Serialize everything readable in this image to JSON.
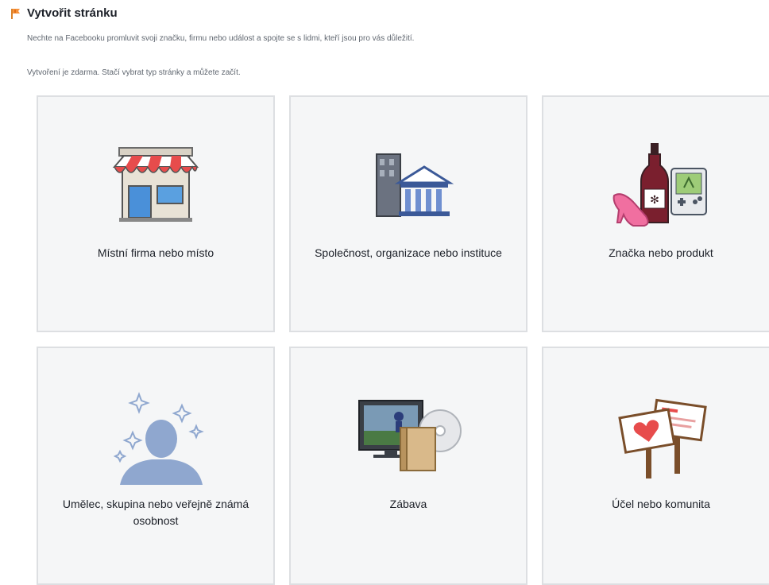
{
  "header": {
    "title": "Vytvořit stránku",
    "description": "Nechte na Facebooku promluvit svoji značku, firmu nebo událost a spojte se s lidmi, kteří jsou pro vás důležití.",
    "note": "Vytvoření je zdarma. Stačí vybrat typ stránky a můžete začít.",
    "flag_icon": "flag-icon",
    "accent": "#f7923b"
  },
  "categories": [
    {
      "label": "Místní firma nebo místo",
      "icon": "storefront-icon"
    },
    {
      "label": "Společnost, organizace nebo instituce",
      "icon": "building-icon"
    },
    {
      "label": "Značka nebo produkt",
      "icon": "products-icon"
    },
    {
      "label": "Umělec, skupina nebo veřejně známá osobnost",
      "icon": "person-sparkle-icon"
    },
    {
      "label": "Zábava",
      "icon": "entertainment-icon"
    },
    {
      "label": "Účel nebo komunita",
      "icon": "signs-icon"
    }
  ]
}
